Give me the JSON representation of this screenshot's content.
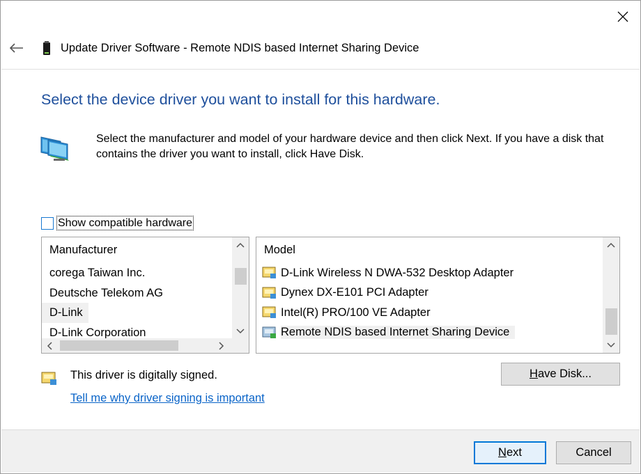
{
  "window": {
    "title": "Update Driver Software - Remote NDIS based Internet Sharing Device"
  },
  "page": {
    "instruction": "Select the device driver you want to install for this hardware.",
    "description": "Select the manufacturer and model of your hardware device and then click Next. If you have a disk that contains the driver you want to install, click Have Disk."
  },
  "compatible": {
    "label": "Show compatible hardware",
    "checked": false
  },
  "manufacturer_list": {
    "header": "Manufacturer",
    "items": [
      {
        "label": "corega Taiwan Inc.",
        "selected": false
      },
      {
        "label": "Deutsche Telekom AG",
        "selected": false
      },
      {
        "label": "D-Link",
        "selected": true
      },
      {
        "label": "D-Link Corporation",
        "selected": false
      }
    ]
  },
  "model_list": {
    "header": "Model",
    "items": [
      {
        "label": "D-Link Wireless N DWA-532 Desktop Adapter",
        "selected": false
      },
      {
        "label": "Dynex DX-E101 PCI Adapter",
        "selected": false
      },
      {
        "label": "Intel(R) PRO/100 VE Adapter",
        "selected": false
      },
      {
        "label": "Remote NDIS based Internet Sharing Device",
        "selected": true
      }
    ]
  },
  "signing": {
    "status": "This driver is digitally signed.",
    "link": "Tell me why driver signing is important"
  },
  "buttons": {
    "have_disk_mnemonic": "H",
    "have_disk_rest": "ave Disk...",
    "next_mnemonic": "N",
    "next_rest": "ext",
    "cancel": "Cancel"
  },
  "colors": {
    "instruction_blue": "#1e4f9c",
    "link_blue": "#0a64c8",
    "default_button_border": "#0078d7"
  }
}
